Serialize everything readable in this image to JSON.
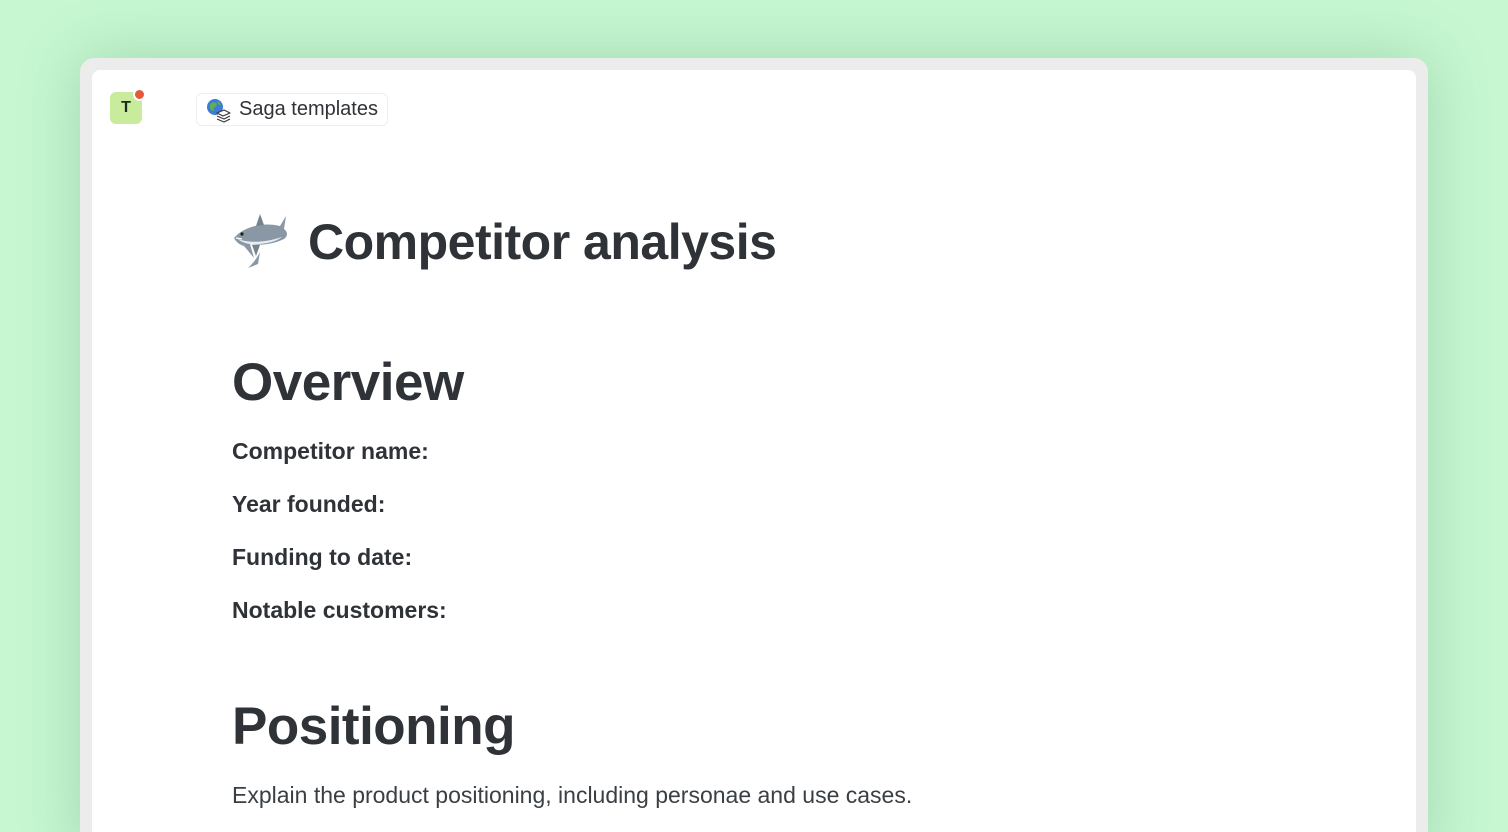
{
  "workspace": {
    "avatar_letter": "T",
    "has_notification": true,
    "notification_color": "#e8593b",
    "avatar_color": "#c8ec9c"
  },
  "breadcrumb": {
    "icon": "globe-stack-icon",
    "label": "Saga templates"
  },
  "page": {
    "icon": "shark-icon",
    "title": "Competitor analysis"
  },
  "sections": {
    "overview": {
      "heading": "Overview",
      "fields": [
        "Competitor name:",
        "Year founded:",
        "Funding to date:",
        "Notable customers:"
      ]
    },
    "positioning": {
      "heading": "Positioning",
      "text": "Explain the product positioning, including personae and use cases."
    }
  },
  "colors": {
    "background": "#c6f7d1",
    "text": "#2f3337"
  }
}
